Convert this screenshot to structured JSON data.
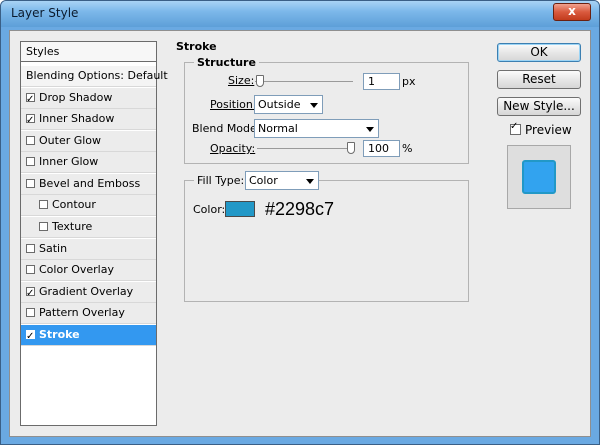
{
  "window": {
    "title": "Layer Style",
    "close_label": "x"
  },
  "sidebar": {
    "header": "Styles",
    "blending_options": "Blending Options: Default",
    "items": [
      {
        "label": "Drop Shadow",
        "checked": true
      },
      {
        "label": "Inner Shadow",
        "checked": true
      },
      {
        "label": "Outer Glow",
        "checked": false
      },
      {
        "label": "Inner Glow",
        "checked": false
      },
      {
        "label": "Bevel and Emboss",
        "checked": false
      },
      {
        "label": "Contour",
        "checked": false
      },
      {
        "label": "Texture",
        "checked": false
      },
      {
        "label": "Satin",
        "checked": false
      },
      {
        "label": "Color Overlay",
        "checked": false
      },
      {
        "label": "Gradient Overlay",
        "checked": true
      },
      {
        "label": "Pattern Overlay",
        "checked": false
      },
      {
        "label": "Stroke",
        "checked": true,
        "selected": true
      }
    ]
  },
  "stroke": {
    "title": "Stroke",
    "structure": {
      "title": "Structure",
      "size_label": "Size:",
      "size_value": "1",
      "size_unit": "px",
      "size_fraction": 0.01,
      "position_label": "Position:",
      "position_value": "Outside",
      "blend_mode_label": "Blend Mode:",
      "blend_mode_value": "Normal",
      "opacity_label": "Opacity:",
      "opacity_value": "100",
      "opacity_unit": "%",
      "opacity_fraction": 1.0
    },
    "fill": {
      "fill_type_label": "Fill Type:",
      "fill_type_value": "Color",
      "color_label": "Color:",
      "color_hex_text": "#2298c7",
      "color": "#2298c7"
    }
  },
  "buttons": {
    "ok": "OK",
    "reset": "Reset",
    "new_style": "New Style...",
    "preview_label": "Preview",
    "preview_checked": true
  },
  "colors": {
    "selection": "#3398f0",
    "stroke_color": "#2298c7",
    "preview_fill": "#32a3ef"
  }
}
